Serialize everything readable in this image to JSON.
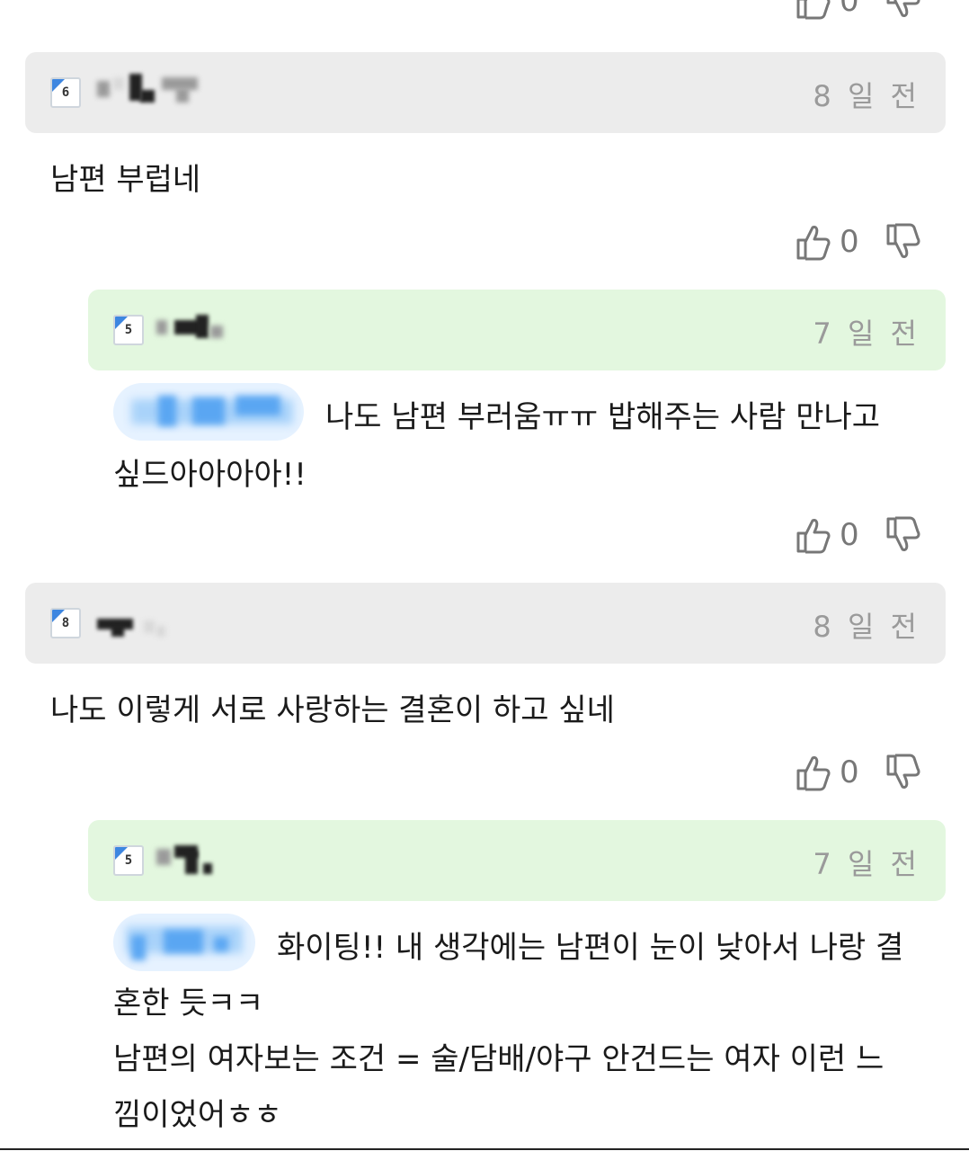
{
  "icons": {
    "like": "thumbs-up-icon",
    "dislike": "thumbs-down-icon"
  },
  "colors": {
    "gray_header": "#ececec",
    "green_header": "#e3f7df",
    "time_text": "#9a9a9a",
    "tag_pill": "#e6f2ff"
  },
  "top_vote": {
    "likes": "0"
  },
  "comments": [
    {
      "level": "6",
      "time": "8 일 전",
      "body": "남편 부럽네",
      "likes": "0",
      "reply": {
        "level": "5",
        "time": "7 일 전",
        "lines": [
          "나도 남편 부러움ㅠㅠ 밥해주는 사람 만나고",
          "싶드아아아아!!"
        ],
        "likes": "0"
      }
    },
    {
      "level": "8",
      "time": "8 일 전",
      "body": "나도 이렇게 서로 사랑하는 결혼이 하고 싶네",
      "likes": "0",
      "reply": {
        "level": "5",
        "time": "7 일 전",
        "lines": [
          "화이팅!! 내 생각에는 남편이 눈이 낮아서 나랑 결",
          "혼한 듯ㅋㅋ",
          "남편의 여자보는 조건 = 술/담배/야구 안건드는 여자 이런 느",
          "낌이었어ㅎㅎ"
        ]
      }
    }
  ]
}
